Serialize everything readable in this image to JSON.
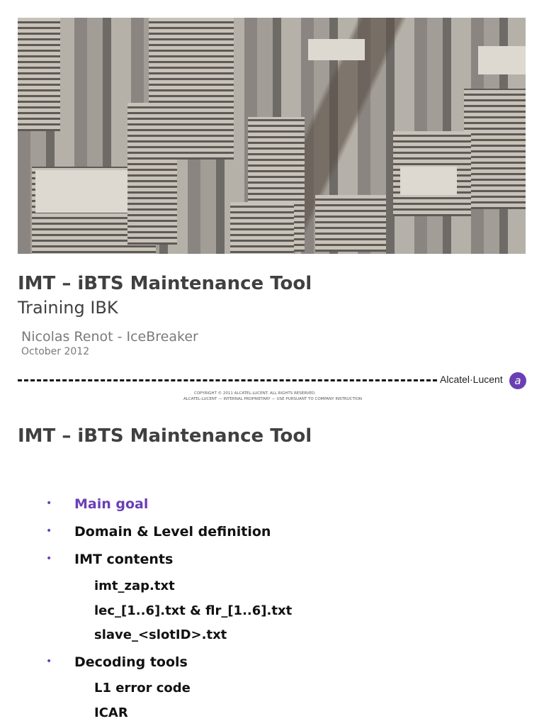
{
  "slide1": {
    "title": "IMT – iBTS Maintenance Tool",
    "subtitle": "Training IBK",
    "author": "Nicolas Renot - IceBreaker",
    "date": "October 2012",
    "logo_text": "Alcatel·Lucent",
    "copyright_line1": "COPYRIGHT © 2011 ALCATEL-LUCENT. ALL RIGHTS RESERVED.",
    "copyright_line2": "ALCATEL-LUCENT — INTERNAL PROPRIETARY — USE PURSUANT TO COMPANY INSTRUCTION"
  },
  "slide2": {
    "title": "IMT – iBTS Maintenance Tool",
    "bullet_symbol": "•",
    "items": [
      {
        "label": "Main goal",
        "level": 1,
        "highlight": true
      },
      {
        "label": "Domain & Level definition",
        "level": 1
      },
      {
        "label": "IMT contents",
        "level": 1
      },
      {
        "label": "imt_zap.txt",
        "level": 2
      },
      {
        "label": "lec_[1..6].txt & flr_[1..6].txt",
        "level": 2
      },
      {
        "label": "slave_<slotID>.txt",
        "level": 2
      },
      {
        "label": "Decoding tools",
        "level": 1
      },
      {
        "label": "L1 error code",
        "level": 2
      },
      {
        "label": "ICAR",
        "level": 2
      }
    ]
  },
  "colors": {
    "accent": "#6a3fb5",
    "text": "#404040"
  }
}
